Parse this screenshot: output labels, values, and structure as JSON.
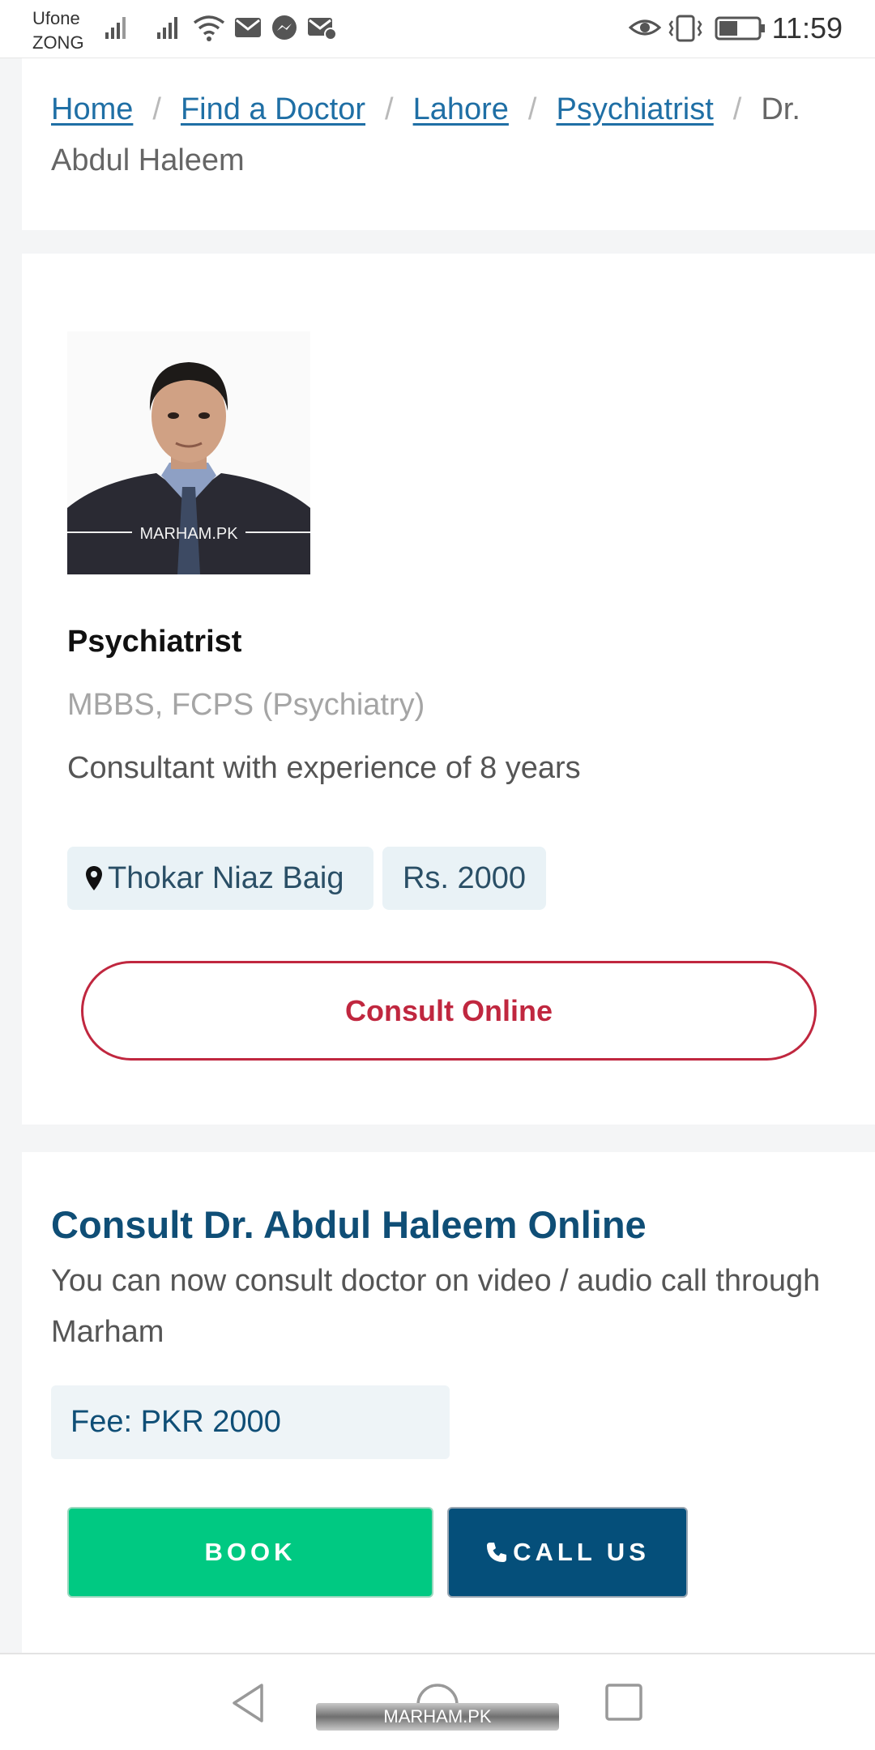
{
  "status_bar": {
    "carrier_1": "Ufone",
    "carrier_2": "ZONG",
    "time": "11:59",
    "icons": [
      "signal-icon",
      "signal-icon",
      "wifi-icon",
      "mail-icon",
      "messenger-icon",
      "mail-settings-icon",
      "eye-icon",
      "vibrate-icon",
      "battery-icon"
    ]
  },
  "breadcrumb": {
    "items": [
      "Home",
      "Find a Doctor",
      "Lahore",
      "Psychiatrist"
    ],
    "separator": "/",
    "current": "Dr. Abdul Haleem"
  },
  "doctor": {
    "photo_watermark": "MARHAM.PK",
    "specialty": "Psychiatrist",
    "qualifications": "MBBS, FCPS (Psychiatry)",
    "experience": "Consultant with experience of 8 years",
    "location": "Thokar Niaz Baig",
    "fee": "Rs. 2000",
    "consult_button": "Consult Online"
  },
  "consult": {
    "title": "Consult Dr. Abdul Haleem Online",
    "description": "You can now consult doctor on video / audio call through Marham",
    "fee": "Fee: PKR 2000",
    "book_button": "BOOK",
    "call_button": "CALL US"
  },
  "nav_bar": {
    "watermark": "MARHAM.PK"
  },
  "colors": {
    "link": "#1f6fa5",
    "brand_blue": "#0f4e76",
    "consult_red": "#c0273f",
    "book_green": "#00c982",
    "call_navy": "#054f7a",
    "chip_bg": "#e9f2f6"
  }
}
